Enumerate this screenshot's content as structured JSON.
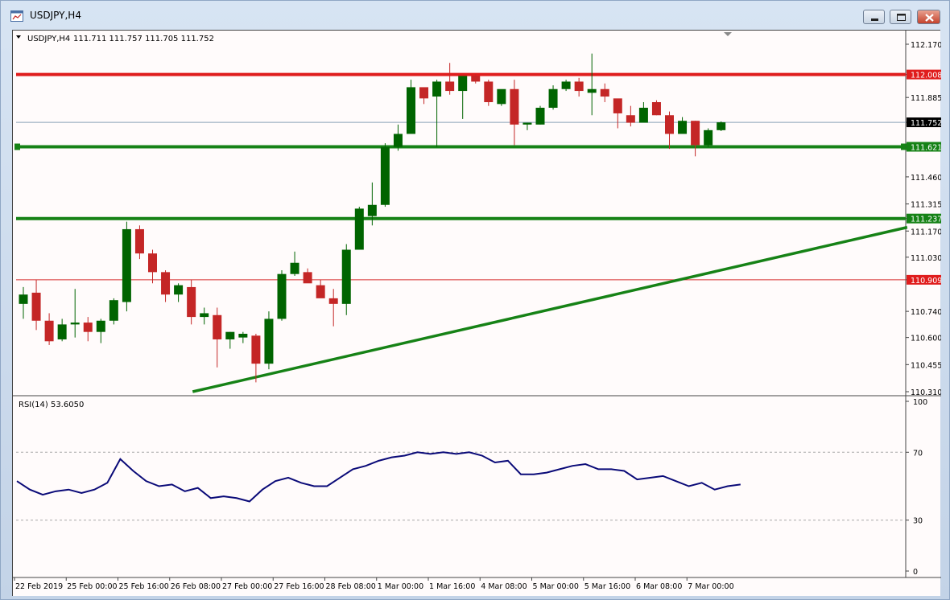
{
  "window": {
    "title": "USDJPY,H4"
  },
  "chart_header": {
    "symbol_label": "USDJPY,H4",
    "ohlc": "111.711 111.757 111.705 111.752"
  },
  "rsi_header": {
    "label": "RSI(14) 53.6050"
  },
  "colors": {
    "bull": "#006400",
    "bear": "#c42626",
    "resistance": "#e01d1d",
    "support": "#168216",
    "rsi_line": "#0a0a78",
    "price_line": "#8aa2b8",
    "thin_red": "#d63131"
  },
  "chart_data": [
    {
      "type": "candlestick",
      "symbol": "USDJPY",
      "timeframe": "H4",
      "ylim": [
        110.31,
        112.17
      ],
      "y_ticks": [
        "112.170",
        "112.008",
        "111.885",
        "111.752",
        "111.621",
        "111.460",
        "111.315",
        "111.237",
        "111.170",
        "111.030",
        "110.909",
        "110.740",
        "110.600",
        "110.455",
        "110.310"
      ],
      "x_labels": [
        "22 Feb 2019",
        "25 Feb 00:00",
        "25 Feb 16:00",
        "26 Feb 08:00",
        "27 Feb 00:00",
        "27 Feb 16:00",
        "28 Feb 08:00",
        "1 Mar 00:00",
        "1 Mar 16:00",
        "4 Mar 08:00",
        "5 Mar 00:00",
        "5 Mar 16:00",
        "6 Mar 08:00",
        "7 Mar 00:00"
      ],
      "current_price": 111.752,
      "levels": [
        {
          "label": "112.008",
          "value": 112.008,
          "kind": "resistance"
        },
        {
          "label": "111.621",
          "value": 111.621,
          "kind": "support"
        },
        {
          "label": "111.237",
          "value": 111.237,
          "kind": "support"
        },
        {
          "label": "110.909",
          "value": 110.909,
          "kind": "thin"
        }
      ],
      "trendline": {
        "from": [
          13.6,
          110.31
        ],
        "to": [
          68.9,
          111.19
        ]
      },
      "candles": [
        [
          110.78,
          110.87,
          110.7,
          110.83
        ],
        [
          110.84,
          110.91,
          110.64,
          110.69
        ],
        [
          110.69,
          110.73,
          110.56,
          110.58
        ],
        [
          110.59,
          110.7,
          110.58,
          110.67
        ],
        [
          110.67,
          110.86,
          110.6,
          110.68
        ],
        [
          110.68,
          110.71,
          110.58,
          110.63
        ],
        [
          110.63,
          110.7,
          110.57,
          110.69
        ],
        [
          110.69,
          110.81,
          110.67,
          110.8
        ],
        [
          110.79,
          111.22,
          110.74,
          111.18
        ],
        [
          111.18,
          111.2,
          111.02,
          111.05
        ],
        [
          111.05,
          111.07,
          110.89,
          110.95
        ],
        [
          110.95,
          110.96,
          110.79,
          110.83
        ],
        [
          110.83,
          110.89,
          110.79,
          110.88
        ],
        [
          110.87,
          110.91,
          110.67,
          110.71
        ],
        [
          110.71,
          110.76,
          110.67,
          110.73
        ],
        [
          110.72,
          110.76,
          110.44,
          110.59
        ],
        [
          110.59,
          110.63,
          110.54,
          110.63
        ],
        [
          110.6,
          110.63,
          110.57,
          110.62
        ],
        [
          110.61,
          110.62,
          110.36,
          110.46
        ],
        [
          110.46,
          110.74,
          110.43,
          110.7
        ],
        [
          110.7,
          110.96,
          110.69,
          110.94
        ],
        [
          110.94,
          111.06,
          110.93,
          111.0
        ],
        [
          110.95,
          110.97,
          110.91,
          110.89
        ],
        [
          110.88,
          110.91,
          110.82,
          110.81
        ],
        [
          110.81,
          110.86,
          110.66,
          110.78
        ],
        [
          110.78,
          111.1,
          110.72,
          111.07
        ],
        [
          111.07,
          111.3,
          111.09,
          111.29
        ],
        [
          111.25,
          111.43,
          111.2,
          111.31
        ],
        [
          111.31,
          111.64,
          111.3,
          111.62
        ],
        [
          111.62,
          111.74,
          111.6,
          111.69
        ],
        [
          111.69,
          111.98,
          111.71,
          111.94
        ],
        [
          111.94,
          111.92,
          111.85,
          111.88
        ],
        [
          111.89,
          111.98,
          111.62,
          111.97
        ],
        [
          111.97,
          112.07,
          111.9,
          111.92
        ],
        [
          111.92,
          112.0,
          111.77,
          112.0
        ],
        [
          112.0,
          112.01,
          111.96,
          111.97
        ],
        [
          111.97,
          111.98,
          111.84,
          111.86
        ],
        [
          111.85,
          111.92,
          111.84,
          111.93
        ],
        [
          111.93,
          111.98,
          111.63,
          111.74
        ],
        [
          111.74,
          111.75,
          111.71,
          111.75
        ],
        [
          111.74,
          111.84,
          111.74,
          111.83
        ],
        [
          111.83,
          111.95,
          111.82,
          111.93
        ],
        [
          111.93,
          111.98,
          111.92,
          111.97
        ],
        [
          111.97,
          111.99,
          111.89,
          111.92
        ],
        [
          111.91,
          112.12,
          111.79,
          111.93
        ],
        [
          111.93,
          111.96,
          111.86,
          111.89
        ],
        [
          111.88,
          111.85,
          111.72,
          111.8
        ],
        [
          111.79,
          111.84,
          111.73,
          111.75
        ],
        [
          111.75,
          111.86,
          111.79,
          111.83
        ],
        [
          111.86,
          111.87,
          111.79,
          111.79
        ],
        [
          111.79,
          111.81,
          111.61,
          111.69
        ],
        [
          111.69,
          111.78,
          111.7,
          111.76
        ],
        [
          111.76,
          111.76,
          111.57,
          111.63
        ],
        [
          111.63,
          111.72,
          111.62,
          111.71
        ],
        [
          111.71,
          111.757,
          111.705,
          111.752
        ]
      ]
    },
    {
      "type": "line",
      "title": "RSI(14) 53.6050",
      "ylim": [
        0,
        100
      ],
      "y_ticks": [
        100,
        70,
        30,
        0
      ],
      "levels": [
        70,
        30
      ],
      "values": [
        53,
        48,
        45,
        47,
        48,
        46,
        48,
        52,
        66,
        59,
        53,
        50,
        51,
        47,
        49,
        43,
        44,
        43,
        41,
        48,
        53,
        55,
        52,
        50,
        50,
        55,
        60,
        62,
        65,
        67,
        68,
        70,
        69,
        70,
        69,
        70,
        68,
        64,
        65,
        57,
        57,
        58,
        60,
        62,
        63,
        60,
        60,
        59,
        54,
        55,
        56,
        53,
        50,
        52,
        48,
        50,
        51
      ]
    }
  ]
}
